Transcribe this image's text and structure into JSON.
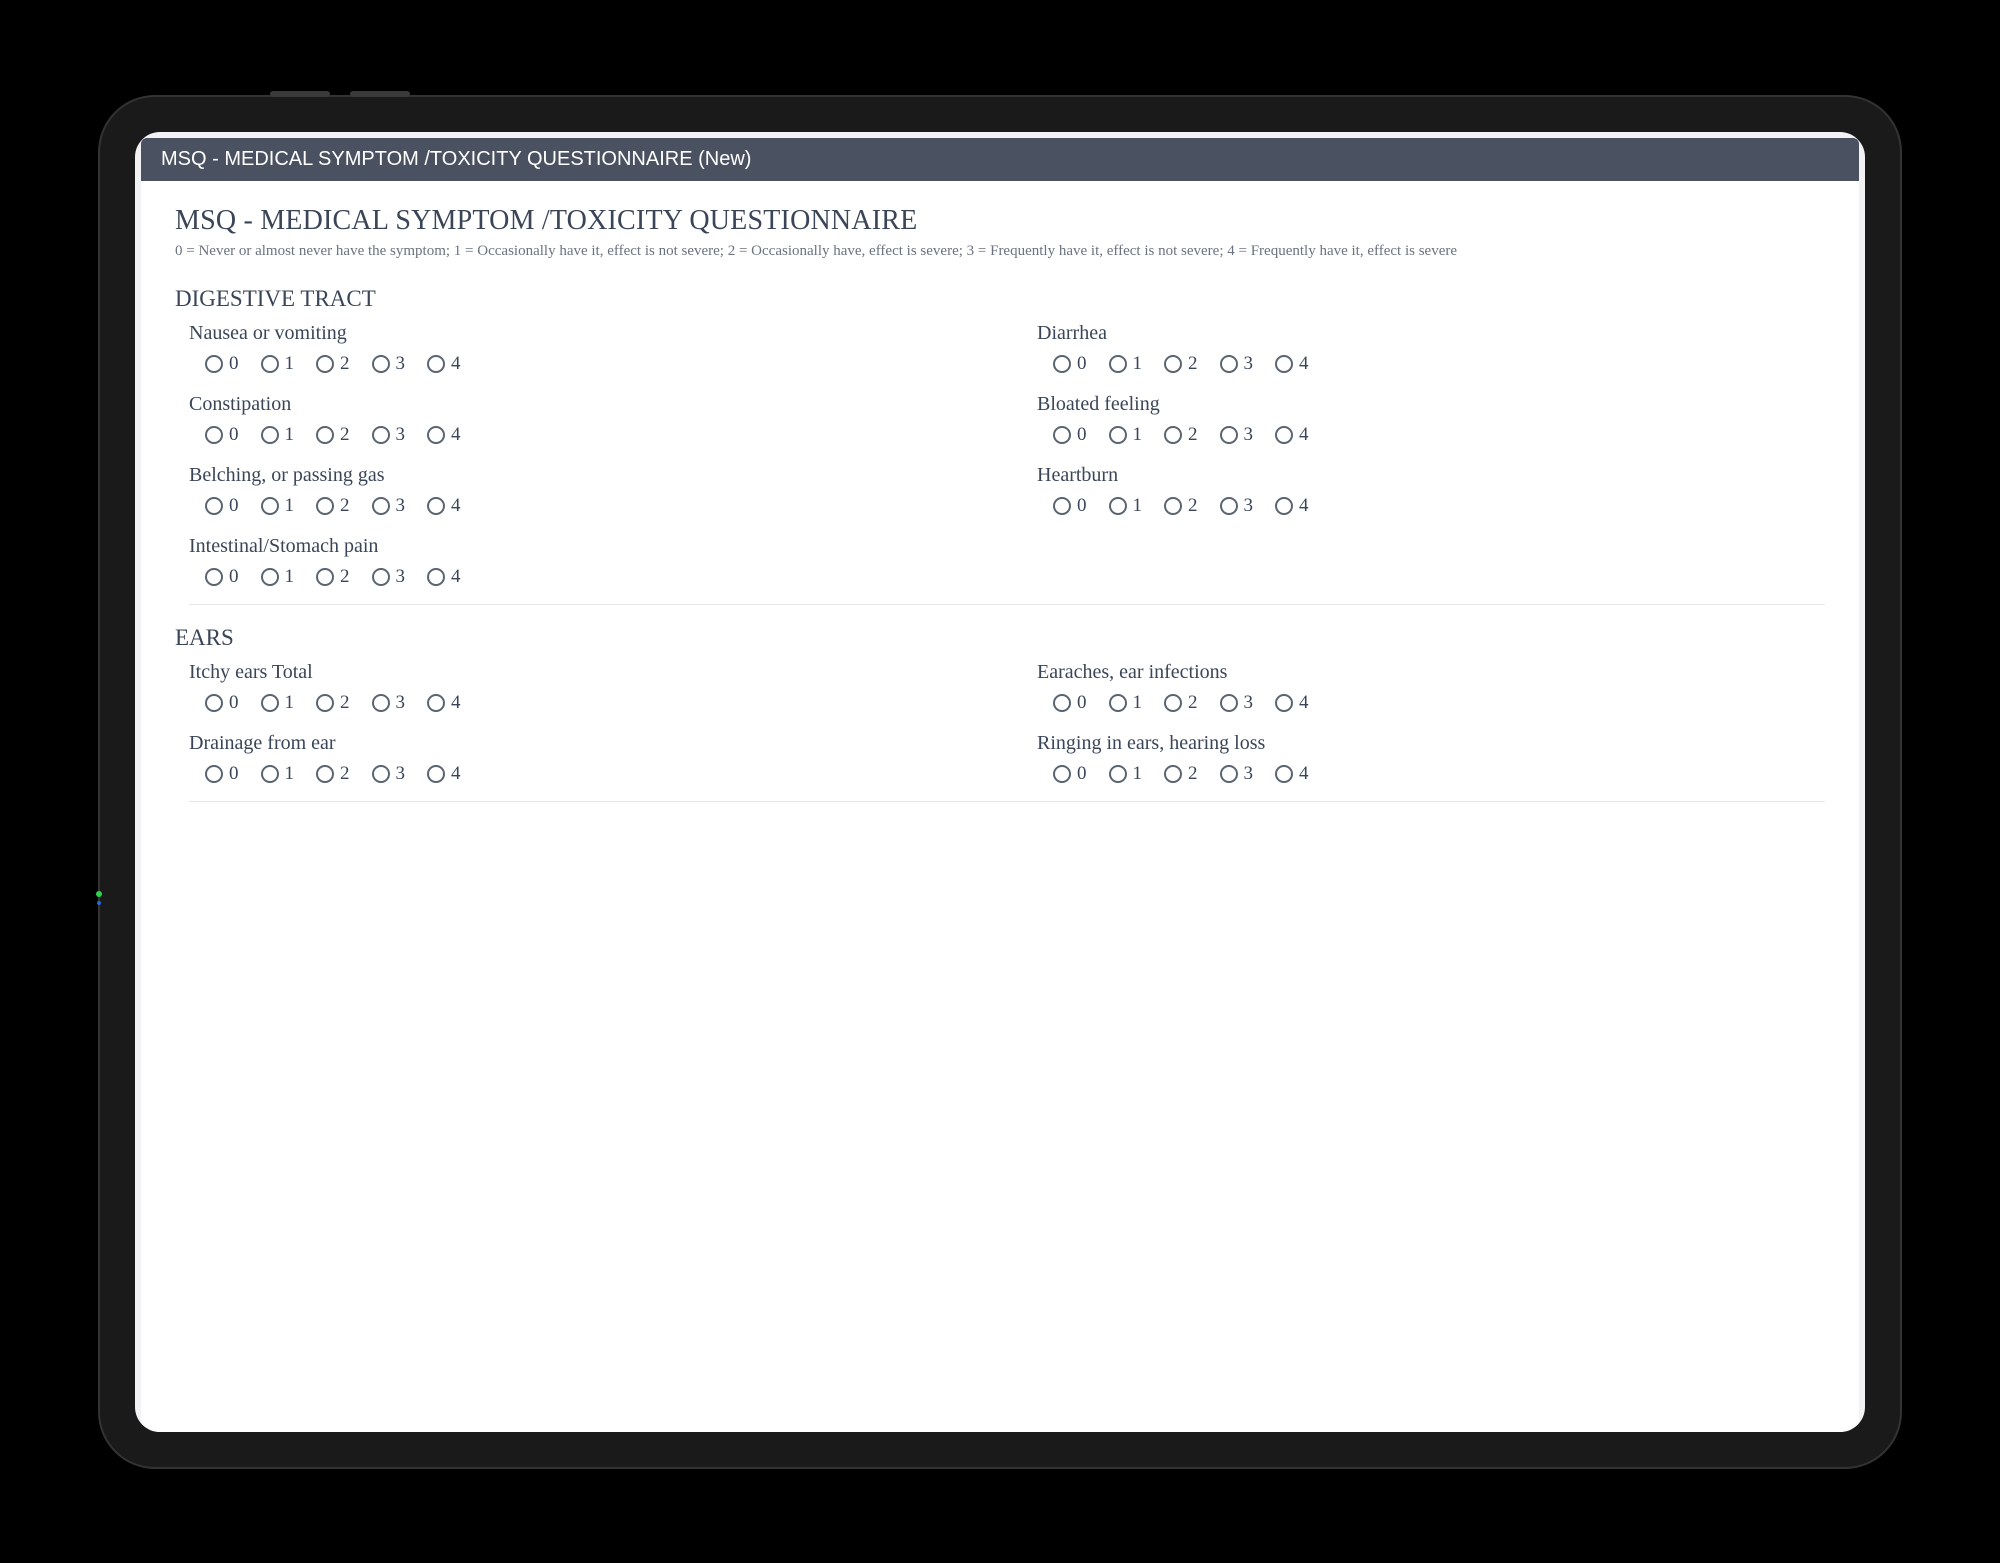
{
  "header": {
    "title": "MSQ - MEDICAL SYMPTOM /TOXICITY QUESTIONNAIRE (New)"
  },
  "form": {
    "title": "MSQ - MEDICAL SYMPTOM /TOXICITY QUESTIONNAIRE",
    "scale_description": "0 = Never or almost never have the symptom; 1 = Occasionally have it, effect is not severe; 2 = Occasionally have, effect is severe; 3 = Frequently have it, effect is not severe; 4 = Frequently have it, effect is severe"
  },
  "options": [
    "0",
    "1",
    "2",
    "3",
    "4"
  ],
  "sections": [
    {
      "title": "DIGESTIVE TRACT",
      "questions": [
        {
          "label": "Nausea or vomiting"
        },
        {
          "label": "Diarrhea"
        },
        {
          "label": "Constipation"
        },
        {
          "label": "Bloated feeling"
        },
        {
          "label": "Belching, or passing gas"
        },
        {
          "label": "Heartburn"
        },
        {
          "label": "Intestinal/Stomach pain"
        }
      ]
    },
    {
      "title": "EARS",
      "questions": [
        {
          "label": "Itchy ears Total"
        },
        {
          "label": "Earaches, ear infections"
        },
        {
          "label": "Drainage from ear"
        },
        {
          "label": "Ringing in ears, hearing loss"
        }
      ]
    }
  ]
}
